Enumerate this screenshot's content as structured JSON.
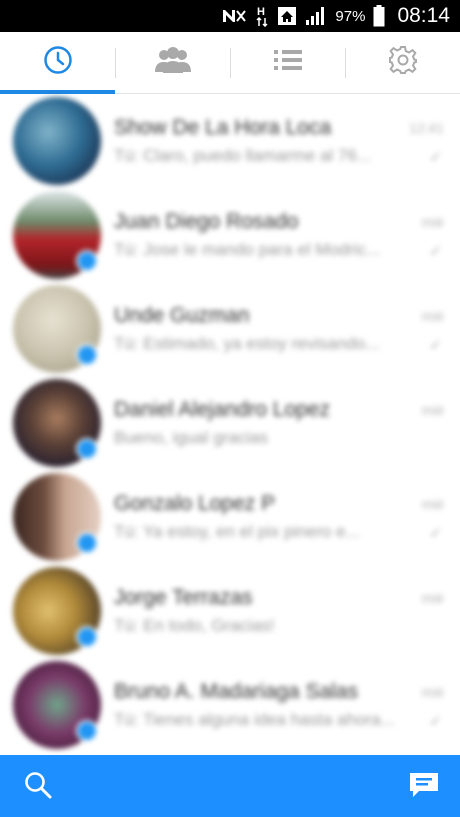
{
  "status_bar": {
    "battery": "97%",
    "time": "08:14",
    "icons": [
      "nfc-icon",
      "hspa-icon",
      "home-icon",
      "signal-icon",
      "battery-icon"
    ]
  },
  "tabs": [
    {
      "name": "recent",
      "icon": "clock-icon",
      "active": true
    },
    {
      "name": "groups",
      "icon": "people-icon",
      "active": false
    },
    {
      "name": "people",
      "icon": "list-icon",
      "active": false
    },
    {
      "name": "settings",
      "icon": "gear-icon",
      "active": false
    }
  ],
  "threads": [
    {
      "name": "Show De La Hora Loca",
      "snippet": "Tú: Claro, puedo llamarme al 76...",
      "time": "12:41"
    },
    {
      "name": "Juan Diego Rosado",
      "snippet": "Tú: Jose le mando para el Modric...",
      "time": "mié"
    },
    {
      "name": "Unde Guzman",
      "snippet": "Tú: Estimado, ya estoy revisando...",
      "time": "mié"
    },
    {
      "name": "Daniel Alejandro Lopez",
      "snippet": "Bueno, igual gracias",
      "time": "mié"
    },
    {
      "name": "Gonzalo Lopez P",
      "snippet": "Tú: Ya estoy, en el pix pinero e...",
      "time": "mié"
    },
    {
      "name": "Jorge Terrazas",
      "snippet": "Tú: En todo, Gracias!",
      "time": "mié"
    },
    {
      "name": "Bruno A. Madariaga Salas",
      "snippet": "Tú: Tienes alguna idea hasta ahora...",
      "time": "mié"
    }
  ],
  "colors": {
    "accent": "#1e88e5",
    "bottom_bar": "#1e8fff",
    "badge": "#2196f3"
  },
  "bottom_bar": {
    "left_icon": "search-icon",
    "right_icon": "compose-icon"
  }
}
